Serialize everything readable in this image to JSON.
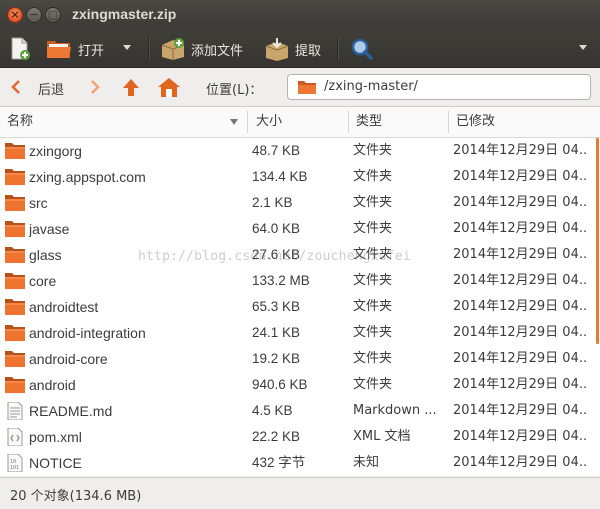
{
  "window": {
    "title": "zxingmaster.zip"
  },
  "toolbar": {
    "open_label": "打开",
    "add_files_label": "添加文件",
    "extract_label": "提取"
  },
  "location": {
    "back_label": "后退",
    "location_label": "位置(L)：",
    "path": "/zxing-master/"
  },
  "columns": {
    "name": "名称",
    "size": "大小",
    "type": "类型",
    "modified": "已修改"
  },
  "files": [
    {
      "name": "zxingorg",
      "size": "48.7 KB",
      "type": "文件夹",
      "modified": "2014年12月29日 04...",
      "icon": "folder-icon"
    },
    {
      "name": "zxing.appspot.com",
      "size": "134.4 KB",
      "type": "文件夹",
      "modified": "2014年12月29日 04...",
      "icon": "folder-icon"
    },
    {
      "name": "src",
      "size": "2.1 KB",
      "type": "文件夹",
      "modified": "2014年12月29日 04...",
      "icon": "folder-icon"
    },
    {
      "name": "javase",
      "size": "64.0 KB",
      "type": "文件夹",
      "modified": "2014年12月29日 04...",
      "icon": "folder-icon"
    },
    {
      "name": "glass",
      "size": "27.6 KB",
      "type": "文件夹",
      "modified": "2014年12月29日 04...",
      "icon": "folder-icon"
    },
    {
      "name": "core",
      "size": "133.2 MB",
      "type": "文件夹",
      "modified": "2014年12月29日 04...",
      "icon": "folder-icon"
    },
    {
      "name": "androidtest",
      "size": "65.3 KB",
      "type": "文件夹",
      "modified": "2014年12月29日 04...",
      "icon": "folder-icon"
    },
    {
      "name": "android-integration",
      "size": "24.1 KB",
      "type": "文件夹",
      "modified": "2014年12月29日 04...",
      "icon": "folder-icon"
    },
    {
      "name": "android-core",
      "size": "19.2 KB",
      "type": "文件夹",
      "modified": "2014年12月29日 04...",
      "icon": "folder-icon"
    },
    {
      "name": "android",
      "size": "940.6 KB",
      "type": "文件夹",
      "modified": "2014年12月29日 04...",
      "icon": "folder-icon"
    },
    {
      "name": "README.md",
      "size": "4.5 KB",
      "type": "Markdown ...",
      "modified": "2014年12月29日 04...",
      "icon": "text-file-icon"
    },
    {
      "name": "pom.xml",
      "size": "22.2 KB",
      "type": "XML 文档",
      "modified": "2014年12月29日 04...",
      "icon": "xml-file-icon"
    },
    {
      "name": "NOTICE",
      "size": "432 字节",
      "type": "未知",
      "modified": "2014年12月29日 04...",
      "icon": "binary-file-icon"
    }
  ],
  "watermark": "http://blog.csdn.net/zouchengxufei",
  "status": {
    "text": "20 个对象(134.6 MB)"
  },
  "colors": {
    "accent": "#e57b3a",
    "folder": "#e9672b",
    "titlebar": "#3c3b37"
  }
}
